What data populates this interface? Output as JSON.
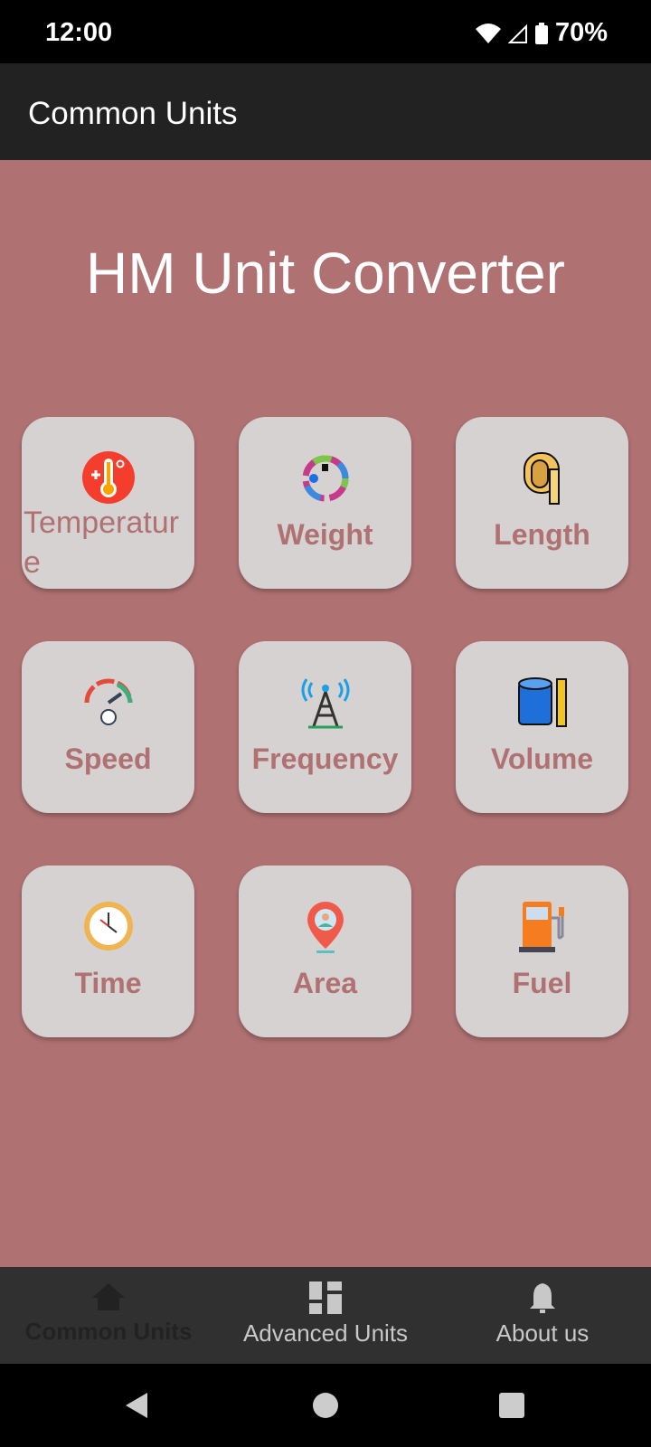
{
  "status": {
    "time": "12:00",
    "battery": "70%"
  },
  "appbar": {
    "title": "Common Units"
  },
  "main": {
    "title": "HM Unit Converter",
    "cards": [
      {
        "label": "Temperature",
        "icon": "thermometer-icon"
      },
      {
        "label": "Weight",
        "icon": "weight-cycle-icon"
      },
      {
        "label": "Length",
        "icon": "tape-measure-icon"
      },
      {
        "label": "Speed",
        "icon": "speedometer-icon"
      },
      {
        "label": "Frequency",
        "icon": "antenna-tower-icon"
      },
      {
        "label": "Volume",
        "icon": "cylinder-icon"
      },
      {
        "label": "Time",
        "icon": "clock-icon"
      },
      {
        "label": "Area",
        "icon": "location-pin-icon"
      },
      {
        "label": "Fuel",
        "icon": "fuel-pump-icon"
      }
    ]
  },
  "bottom_nav": {
    "items": [
      {
        "label": "Common Units",
        "icon": "home-icon",
        "active": true
      },
      {
        "label": "Advanced Units",
        "icon": "dashboard-icon"
      },
      {
        "label": "About us",
        "icon": "bell-icon"
      }
    ]
  },
  "colors": {
    "background": "#af7171",
    "card": "#d6d2d2",
    "appbar": "#222222",
    "bottom_nav": "#303030"
  }
}
